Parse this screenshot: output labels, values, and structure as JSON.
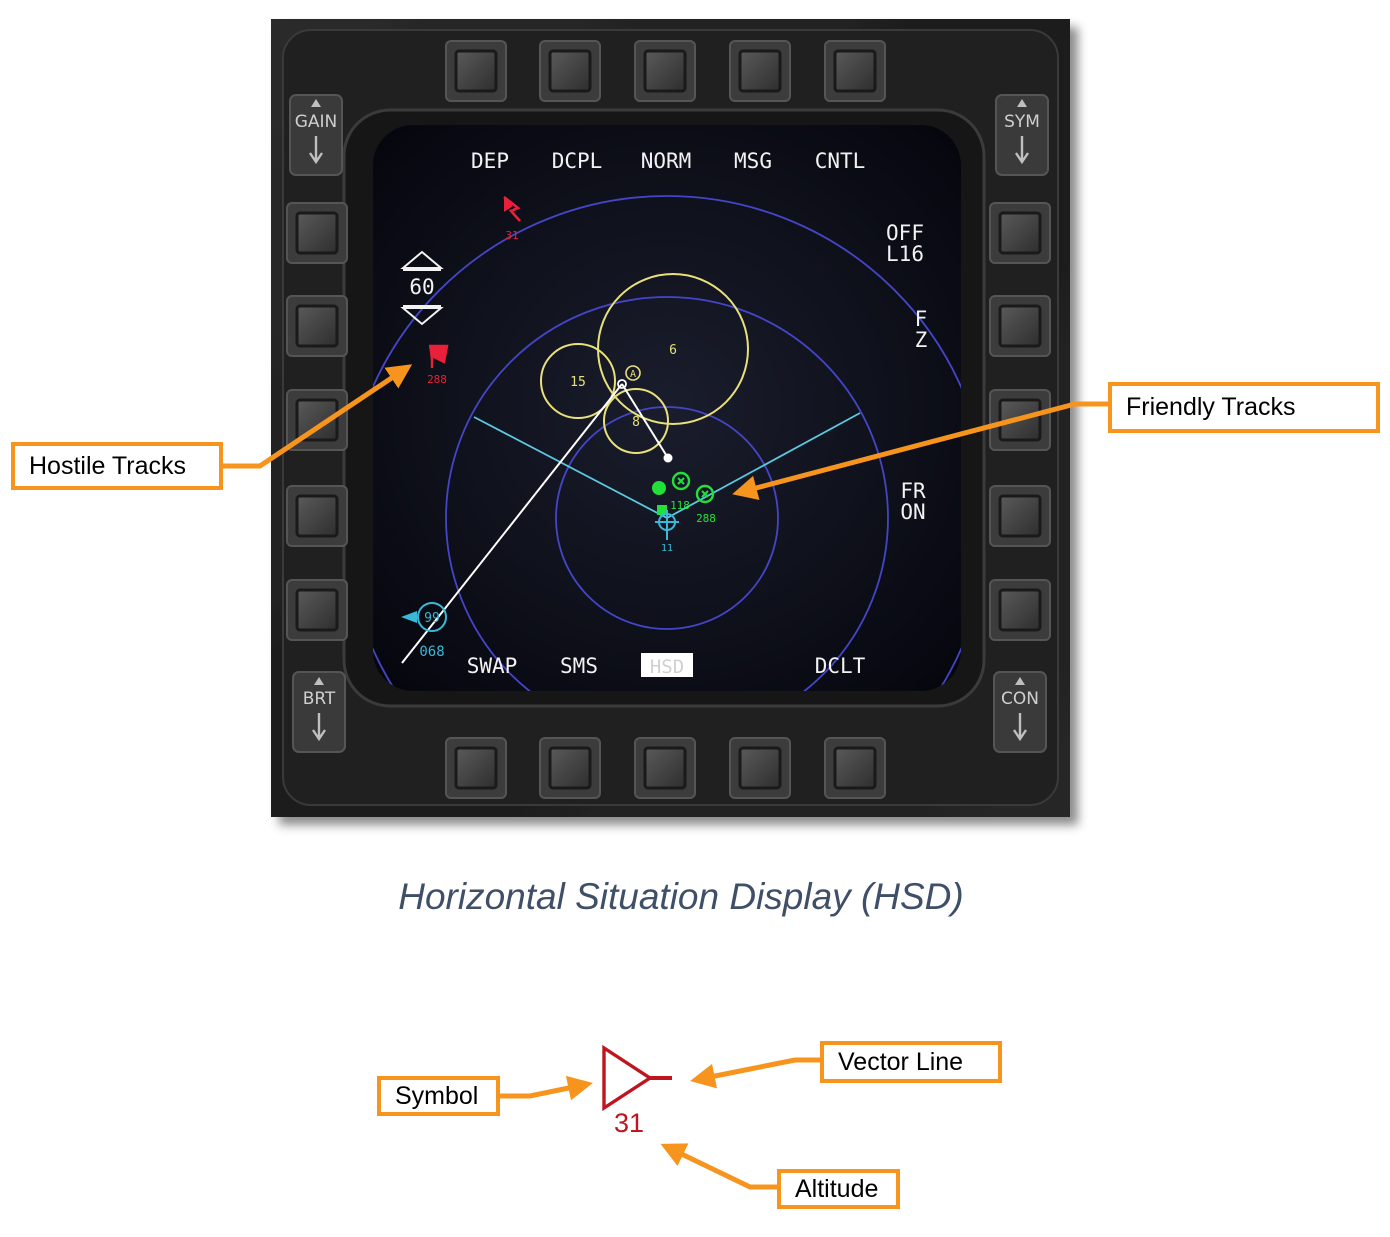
{
  "display": {
    "top_labels": [
      "DEP",
      "DCPL",
      "NORM",
      "MSG",
      "CNTL"
    ],
    "bottom_labels": [
      "SWAP",
      "SMS",
      "HSD",
      "DCLT"
    ],
    "rocker_gain": "GAIN",
    "rocker_sym": "SYM",
    "rocker_brt": "BRT",
    "rocker_con": "CON",
    "right_off": "OFF",
    "right_l16": "L16",
    "right_f": "F",
    "right_z": "Z",
    "right_fr": "FR",
    "right_on": "ON",
    "range_value": "60",
    "hostile_alt_top": "31",
    "hostile_alt_left": "288",
    "circle_label_large": "6",
    "circle_label_left": "15",
    "circle_label_small": "8",
    "waypoint_letter": "A",
    "friendly_alt_1": "118",
    "friendly_alt_2": "288",
    "friendly_alt_3": "",
    "ownship_alt": "11",
    "cyan_track_label": "99",
    "cyan_track_alt": "068"
  },
  "callouts": {
    "hostile_tracks": "Hostile Tracks",
    "friendly_tracks": "Friendly Tracks",
    "symbol": "Symbol",
    "vector_line": "Vector Line",
    "altitude": "Altitude"
  },
  "caption": "Horizontal Situation Display (HSD)",
  "legend": {
    "altitude_value": "31"
  },
  "colors": {
    "callout_orange": "#f7941d",
    "hostile_red": "#e8203a",
    "friendly_green": "#22e03a",
    "ownship_cyan": "#3ab8d8",
    "range_ring_blue": "#4444cc",
    "threat_yellow": "#e8e07a",
    "legend_red": "#c0141e"
  }
}
